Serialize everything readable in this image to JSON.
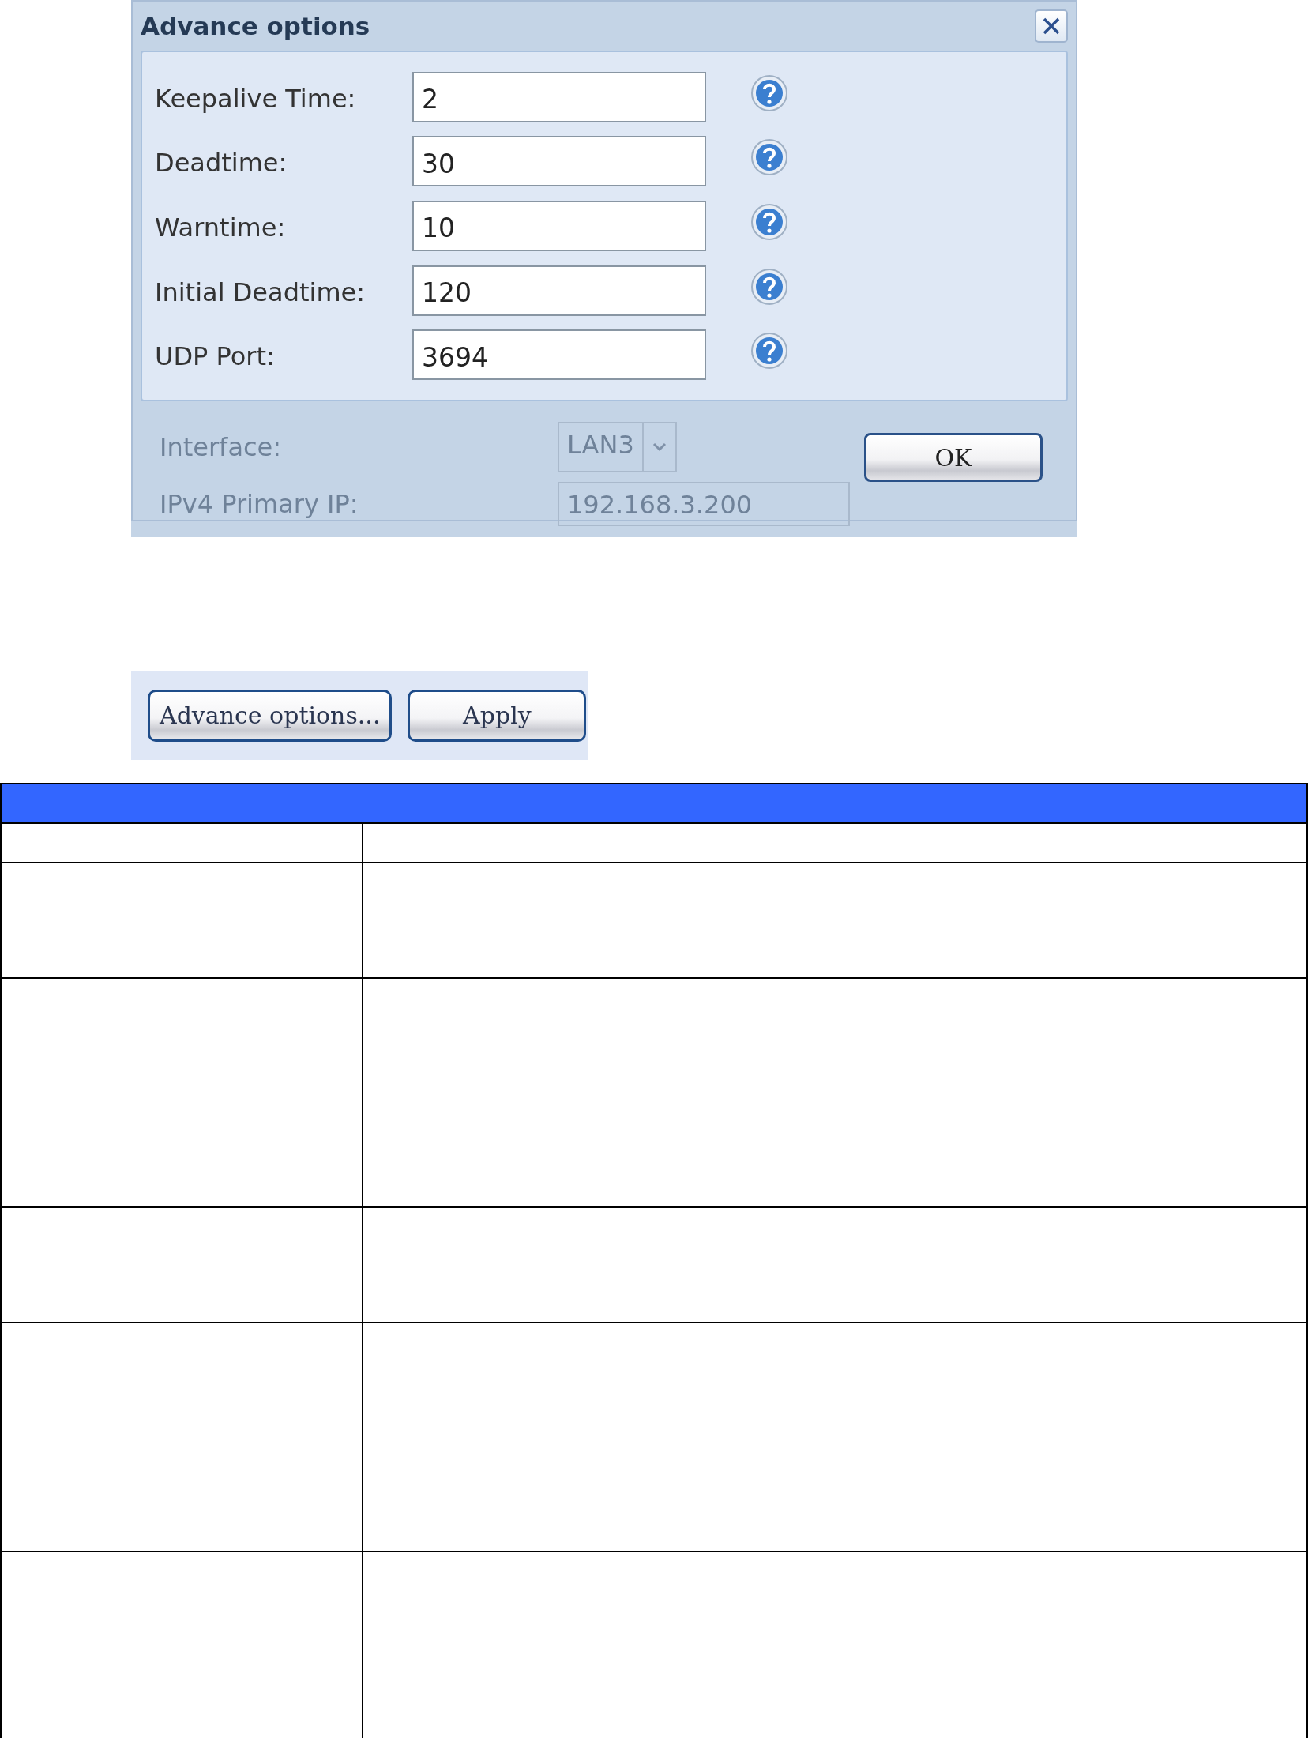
{
  "background": {
    "rows": [
      {
        "label": "Interface:",
        "value": "LAN3",
        "kind": "select"
      },
      {
        "label": "IPv4 Primary IP:",
        "value": "192.168.3.200",
        "kind": "text"
      }
    ]
  },
  "dialog": {
    "title": "Advance options",
    "fields": [
      {
        "label": "Keepalive Time:",
        "value": "2"
      },
      {
        "label": "Deadtime:",
        "value": "30"
      },
      {
        "label": "Warntime:",
        "value": "10"
      },
      {
        "label": "Initial Deadtime:",
        "value": "120"
      },
      {
        "label": "UDP Port:",
        "value": "3694"
      }
    ],
    "buttons": [
      "OK"
    ]
  },
  "buttons": [
    "Advance options...",
    "Apply"
  ]
}
